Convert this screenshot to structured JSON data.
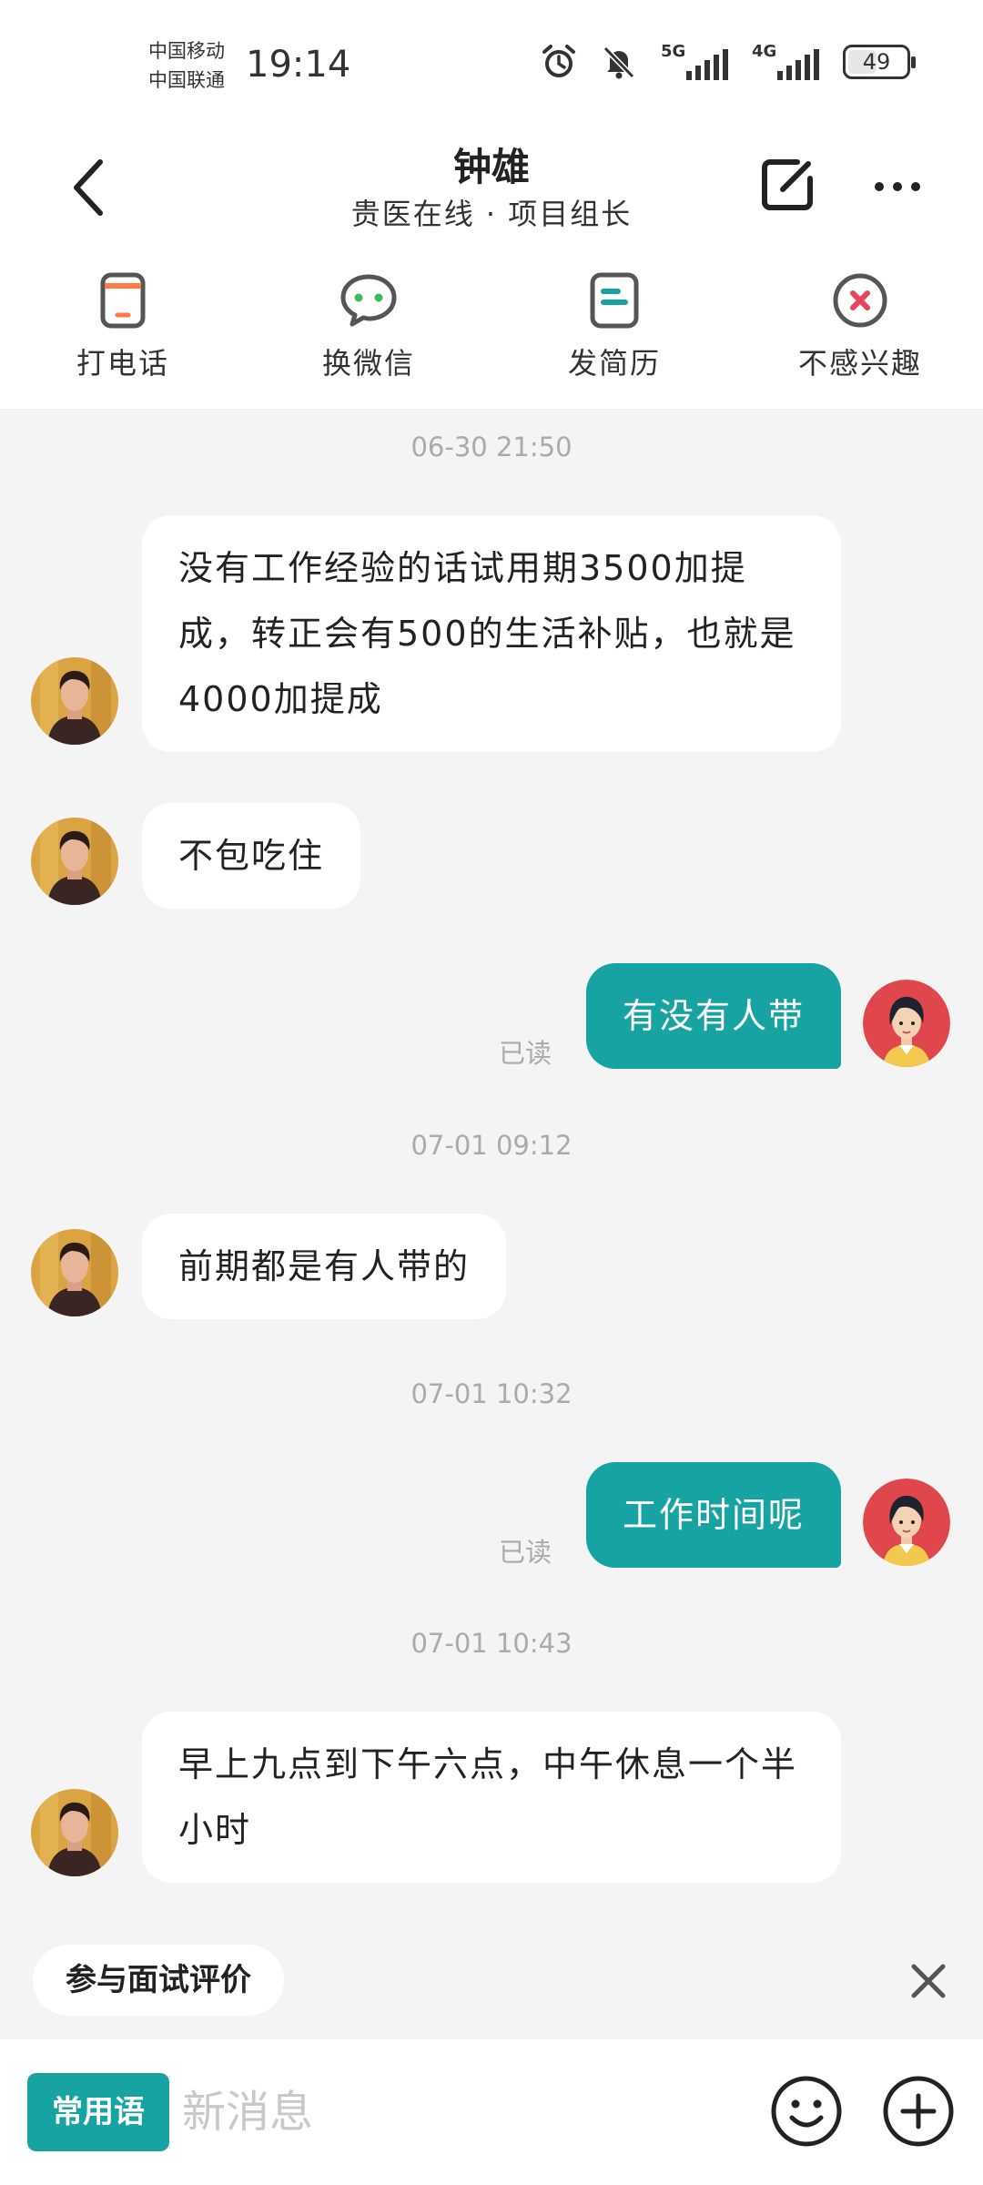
{
  "status_bar": {
    "carrier_1": "中国移动",
    "carrier_2": "中国联通",
    "time": "19:14",
    "net_1": "5G",
    "net_2": "4G",
    "battery": "49"
  },
  "header": {
    "title": "钟雄",
    "subtitle": "贵医在线 · 项目组长"
  },
  "actions": [
    {
      "label": "打电话",
      "icon": "phone-icon"
    },
    {
      "label": "换微信",
      "icon": "wechat-icon"
    },
    {
      "label": "发简历",
      "icon": "resume-icon"
    },
    {
      "label": "不感兴趣",
      "icon": "not-interested-icon"
    }
  ],
  "chat": {
    "times": [
      "06-30 21:50",
      "07-01 09:12",
      "07-01 10:32",
      "07-01 10:43"
    ],
    "messages": [
      {
        "from": "other",
        "text": "没有工作经验的话试用期3500加提成，转正会有500的生活补贴，也就是4000加提成"
      },
      {
        "from": "other",
        "text": "不包吃住"
      },
      {
        "from": "me",
        "text": "有没有人带",
        "status": "已读"
      },
      {
        "from": "other",
        "text": "前期都是有人带的"
      },
      {
        "from": "me",
        "text": "工作时间呢",
        "status": "已读"
      },
      {
        "from": "other",
        "text": "早上九点到下午六点，中午休息一个半小时"
      }
    ]
  },
  "bottom": {
    "review_chip": "参与面试评价",
    "quick_phrase": "常用语",
    "input_placeholder": "新消息"
  },
  "colors": {
    "accent": "#18a3a3",
    "background": "#f4f4f4"
  }
}
